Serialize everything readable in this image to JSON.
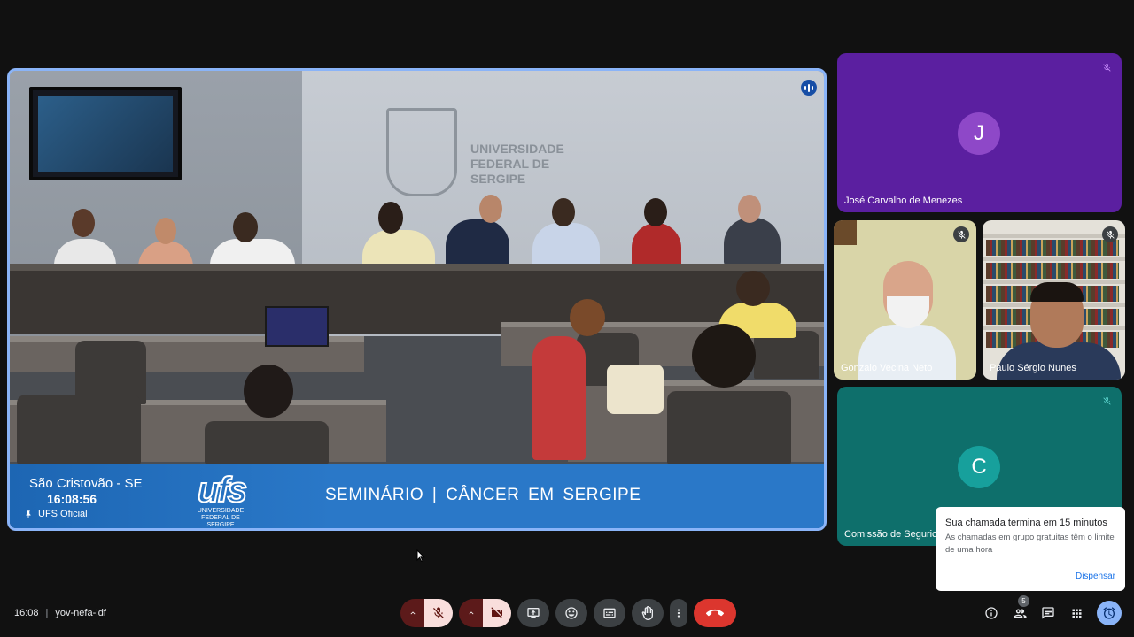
{
  "main_stream": {
    "wall_text": [
      "UNIVERSIDADE",
      "FEDERAL DE",
      "SERGIPE"
    ],
    "lower_third": {
      "city": "São Cristovão - SE",
      "time": "16:08:56",
      "channel": "UFS Oficial",
      "logo_text": "ufs",
      "logo_sub": [
        "UNIVERSIDADE",
        "FEDERAL DE",
        "SERGIPE"
      ],
      "title": "SEMINÁRIO |  CÂNCER  EM  SERGIPE"
    }
  },
  "participants": [
    {
      "name": "José Carvalho de Menezes",
      "initial": "J",
      "color": "#5b1fa0",
      "muted": true
    },
    {
      "name": "Gonzalo Vecina Neto",
      "muted": true
    },
    {
      "name": "Paulo Sérgio Nunes",
      "muted": true
    },
    {
      "name": "Comissão de Seguric",
      "initial": "C",
      "color": "#0e6f6b",
      "muted": true
    }
  ],
  "toast": {
    "title": "Sua chamada termina em 15 minutos",
    "body": "As chamadas em grupo gratuitas têm o limite de uma hora",
    "button": "Dispensar"
  },
  "bottom_bar": {
    "time": "16:08",
    "meeting_code": "yov-nefa-idf",
    "people_count": "5"
  },
  "colors": {
    "accent": "#8ab4f8",
    "end_call": "#dc362e",
    "muted_bg": "#f9dedc"
  },
  "icons": [
    "audio-bars-icon",
    "mic-off-icon",
    "pin-icon",
    "chevron-up-icon",
    "camera-off-icon",
    "present-icon",
    "emoji-icon",
    "captions-icon",
    "hand-icon",
    "more-vert-icon",
    "end-call-icon",
    "info-icon",
    "people-icon",
    "chat-icon",
    "apps-icon",
    "timer-icon"
  ]
}
